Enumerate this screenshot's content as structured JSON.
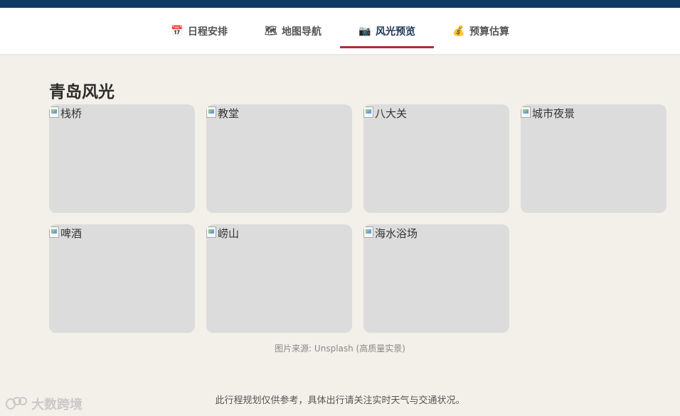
{
  "nav": {
    "tabs": [
      {
        "icon": "calendar-icon",
        "glyph": "📅",
        "label": "日程安排"
      },
      {
        "icon": "map-icon",
        "glyph": "🗺",
        "label": "地图导航"
      },
      {
        "icon": "camera-icon",
        "glyph": "📷",
        "label": "风光预览",
        "active": true
      },
      {
        "icon": "money-bag-icon",
        "glyph": "💰",
        "label": "预算估算"
      }
    ]
  },
  "gallery": {
    "title": "青岛风光",
    "items": [
      {
        "alt": "栈桥"
      },
      {
        "alt": "教堂"
      },
      {
        "alt": "八大关"
      },
      {
        "alt": "城市夜景"
      },
      {
        "alt": "啤酒"
      },
      {
        "alt": "崂山"
      },
      {
        "alt": "海水浴场"
      }
    ],
    "caption": "图片来源: Unsplash (高质量实景)"
  },
  "footer": {
    "note": "此行程规划仅供参考，具体出行请关注实时天气与交通状况。"
  },
  "watermark": {
    "text": "大数跨境"
  },
  "colors": {
    "header_bar": "#0f3a66",
    "active_tab_underline": "#a8323a",
    "page_background": "#f3f0ea",
    "card_placeholder": "#dcdcdc"
  }
}
